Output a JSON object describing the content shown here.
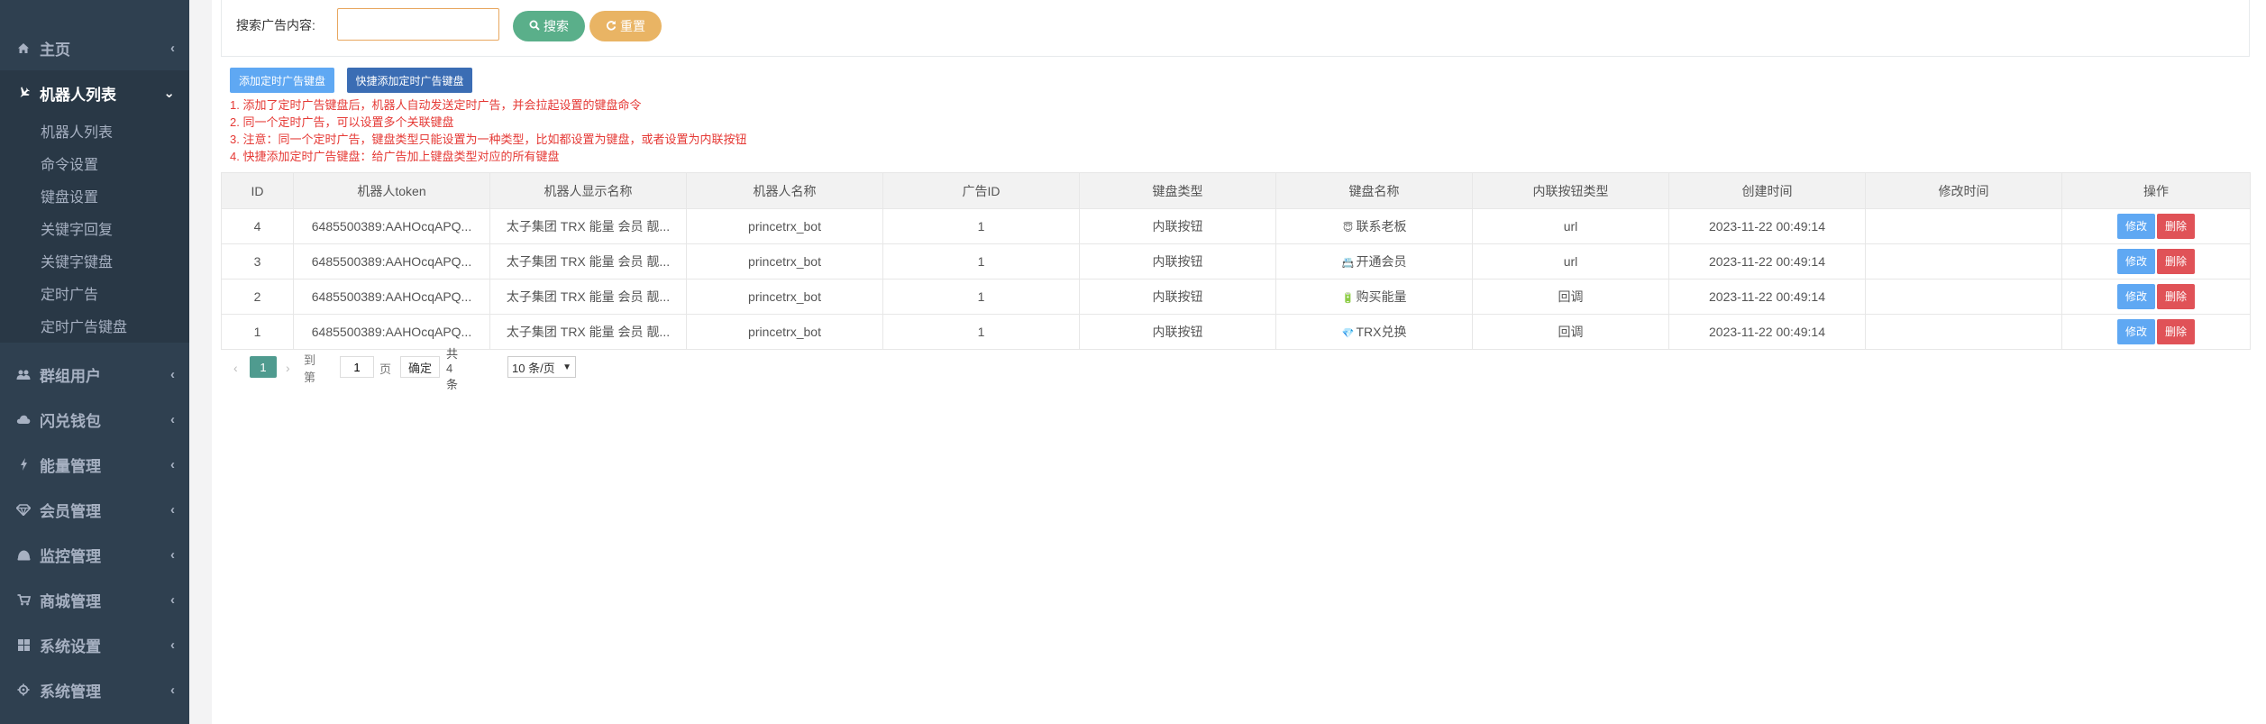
{
  "sidebar": {
    "home": {
      "label": "主页",
      "icon": "home-icon"
    },
    "robots": {
      "label": "机器人列表",
      "icon": "plane-icon"
    },
    "sub_items": [
      {
        "label": "机器人列表"
      },
      {
        "label": "命令设置"
      },
      {
        "label": "键盘设置"
      },
      {
        "label": "关键字回复"
      },
      {
        "label": "关键字键盘"
      },
      {
        "label": "定时广告"
      },
      {
        "label": "定时广告键盘"
      }
    ],
    "groups": {
      "label": "群组用户",
      "icon": "users-icon"
    },
    "flash_wallet": {
      "label": "闪兑钱包",
      "icon": "cloud-icon"
    },
    "energy": {
      "label": "能量管理",
      "icon": "bolt-icon"
    },
    "member": {
      "label": "会员管理",
      "icon": "diamond-icon"
    },
    "monitor": {
      "label": "监控管理",
      "icon": "monitor-icon"
    },
    "shop": {
      "label": "商城管理",
      "icon": "cart-icon"
    },
    "system_settings": {
      "label": "系统设置",
      "icon": "windows-icon"
    },
    "system_manage": {
      "label": "系统管理",
      "icon": "gear-icon"
    }
  },
  "search": {
    "label": "搜索广告内容:",
    "value": "",
    "search_btn": "搜索",
    "reset_btn": "重置"
  },
  "toolbar": {
    "add_btn": "添加定时广告键盘",
    "quick_add_btn": "快捷添加定时广告键盘"
  },
  "notes": [
    "1. 添加了定时广告键盘后，机器人自动发送定时广告，并会拉起设置的键盘命令",
    "2. 同一个定时广告，可以设置多个关联键盘",
    "3. 注意：同一个定时广告，键盘类型只能设置为一种类型，比如都设置为键盘，或者设置为内联按钮",
    "4. 快捷添加定时广告键盘：给广告加上键盘类型对应的所有键盘"
  ],
  "table": {
    "headers": [
      "ID",
      "机器人token",
      "机器人显示名称",
      "机器人名称",
      "广告ID",
      "键盘类型",
      "键盘名称",
      "内联按钮类型",
      "创建时间",
      "修改时间",
      "操作"
    ],
    "rows": [
      {
        "id": "4",
        "token": "6485500389:AAHOcqAPQ...",
        "display_name": "太子集团 TRX 能量 会员 靓...",
        "bot_name": "princetrx_bot",
        "ad_id": "1",
        "kb_type": "内联按钮",
        "kb_emoji": "😇",
        "kb_name": "联系老板",
        "inline_type": "url",
        "created": "2023-11-22 00:49:14",
        "modified": ""
      },
      {
        "id": "3",
        "token": "6485500389:AAHOcqAPQ...",
        "display_name": "太子集团 TRX 能量 会员 靓...",
        "bot_name": "princetrx_bot",
        "ad_id": "1",
        "kb_type": "内联按钮",
        "kb_emoji": "📇",
        "kb_name": "开通会员",
        "inline_type": "url",
        "created": "2023-11-22 00:49:14",
        "modified": ""
      },
      {
        "id": "2",
        "token": "6485500389:AAHOcqAPQ...",
        "display_name": "太子集团 TRX 能量 会员 靓...",
        "bot_name": "princetrx_bot",
        "ad_id": "1",
        "kb_type": "内联按钮",
        "kb_emoji": "🔋",
        "kb_name": "购买能量",
        "inline_type": "回调",
        "created": "2023-11-22 00:49:14",
        "modified": ""
      },
      {
        "id": "1",
        "token": "6485500389:AAHOcqAPQ...",
        "display_name": "太子集团 TRX 能量 会员 靓...",
        "bot_name": "princetrx_bot",
        "ad_id": "1",
        "kb_type": "内联按钮",
        "kb_emoji": "💎",
        "kb_name": "TRX兑换",
        "inline_type": "回调",
        "created": "2023-11-22 00:49:14",
        "modified": ""
      }
    ],
    "edit_label": "修改",
    "delete_label": "删除"
  },
  "pager": {
    "current_page": "1",
    "goto_label": "到第",
    "goto_value": "1",
    "page_unit": "页",
    "confirm": "确定",
    "total": "共 4 条",
    "page_size": "10 条/页"
  }
}
